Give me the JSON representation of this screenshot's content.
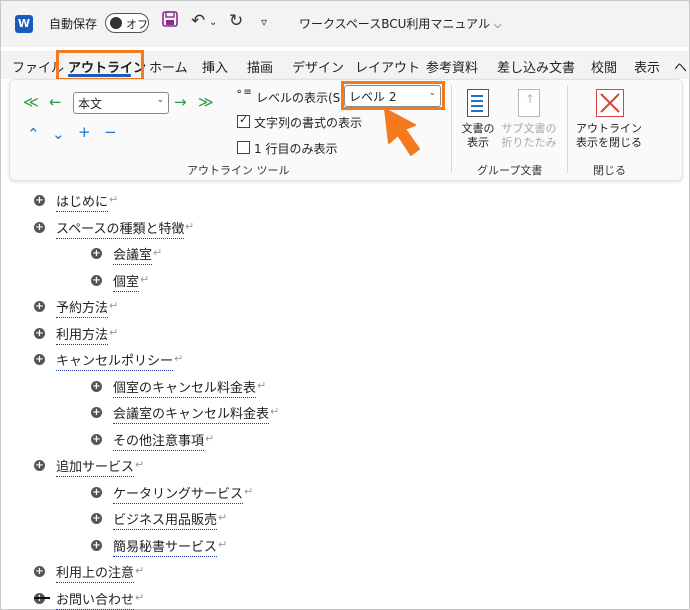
{
  "titlebar": {
    "app_icon": "W",
    "autosave_label": "自動保存",
    "autosave_state": "オフ",
    "doc_title": "ワークスペースBCU利用マニュアル",
    "icons": [
      "save-icon",
      "undo-icon",
      "redo-icon",
      "customize-qat-icon"
    ]
  },
  "ribbon_tabs": [
    {
      "label": "ファイル"
    },
    {
      "label": "アウトライン",
      "active": true
    },
    {
      "label": "ホーム"
    },
    {
      "label": "挿入"
    },
    {
      "label": "描画"
    },
    {
      "label": "デザイン"
    },
    {
      "label": "レイアウト"
    },
    {
      "label": "参考資料"
    },
    {
      "label": "差し込み文書"
    },
    {
      "label": "校閲"
    },
    {
      "label": "表示"
    },
    {
      "label": "ヘ"
    }
  ],
  "outline_tools": {
    "style_select_value": "本文",
    "level_label": "レベルの表示(S):",
    "level_value": "レベル 2",
    "show_text_formatting": "文字列の書式の表示",
    "show_first_line_only": "1 行目のみ表示",
    "group_label": "アウトライン ツール",
    "colors": {
      "promote_demote": "#2b9a48",
      "move": "#1f73c8"
    }
  },
  "master_document": {
    "show_document": [
      "文書の",
      "表示"
    ],
    "collapse_subdocs": [
      "サブ文書の",
      "折りたたみ"
    ],
    "group_label": "グループ文書"
  },
  "close": {
    "close_outline": [
      "アウトライン",
      "表示を閉じる"
    ],
    "group_label": "閉じる"
  },
  "outline": [
    {
      "text": "はじめに",
      "level": 1
    },
    {
      "text": "スペースの種類と特徴",
      "level": 1
    },
    {
      "text": "会議室",
      "level": 2
    },
    {
      "text": "個室",
      "level": 2
    },
    {
      "text": "予約方法",
      "level": 1
    },
    {
      "text": "利用方法",
      "level": 1
    },
    {
      "text": "キャンセルポリシー",
      "level": 1
    },
    {
      "text": "個室のキャンセル料金表",
      "level": 2
    },
    {
      "text": "会議室のキャンセル料金表",
      "level": 2
    },
    {
      "text": "その他注意事項",
      "level": 2
    },
    {
      "text": "追加サービス",
      "level": 1
    },
    {
      "text": "ケータリングサービス",
      "level": 2
    },
    {
      "text": "ビジネス用品販売",
      "level": 2
    },
    {
      "text": "簡易秘書サービス",
      "level": 2
    },
    {
      "text": "利用上の注意",
      "level": 1
    },
    {
      "text": "お問い合わせ",
      "level": 1
    }
  ],
  "paragraph_mark": "↵",
  "accent_color": "#f4791f"
}
